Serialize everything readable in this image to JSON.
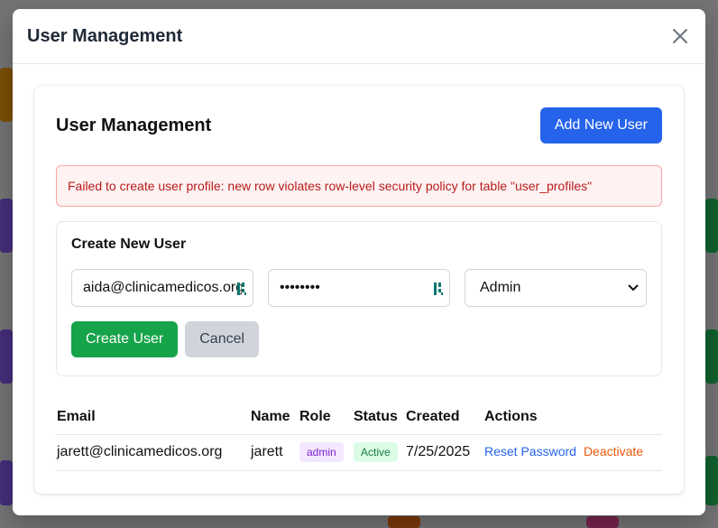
{
  "modal": {
    "title": "User Management"
  },
  "card": {
    "title": "User Management",
    "add_button": "Add New User"
  },
  "error": {
    "message": "Failed to create user profile: new row violates row-level security policy for table \"user_profiles\""
  },
  "create_form": {
    "title": "Create New User",
    "email_value": "aida@clinicamedicos.org",
    "password_value": "••••••••",
    "role_selected": "Admin",
    "create_button": "Create User",
    "cancel_button": "Cancel"
  },
  "table": {
    "headers": [
      "Email",
      "Name",
      "Role",
      "Status",
      "Created",
      "Actions"
    ],
    "rows": [
      {
        "email": "jarett@clinicamedicos.org",
        "name": "jarett",
        "role": "admin",
        "status": "Active",
        "created": "7/25/2025",
        "reset_action": "Reset Password",
        "deactivate_action": "Deactivate"
      }
    ]
  },
  "icons": {
    "close": "close-icon",
    "password_manager": "password-manager-icon",
    "dropdown": "chevron-down-icon"
  },
  "colors": {
    "primary": "#2563eb",
    "success": "#16a34a",
    "error_bg": "#fef2f2",
    "error_text": "#b91c1c",
    "role_badge": "#7e22ce",
    "status_badge": "#15803d",
    "deactivate": "#ea580c"
  }
}
